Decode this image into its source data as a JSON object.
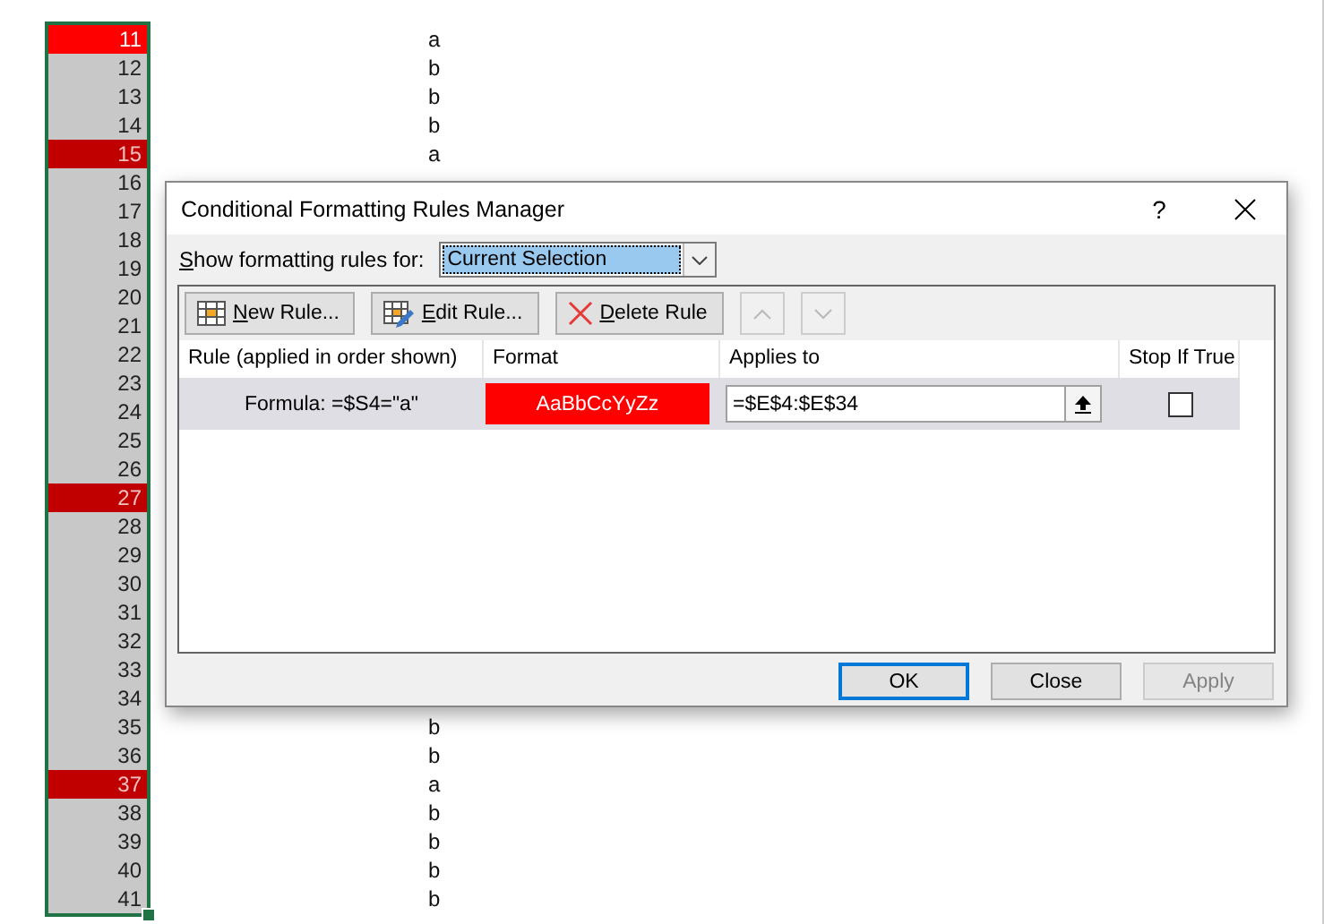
{
  "sheet": {
    "rows": [
      {
        "number": "11",
        "value": "a",
        "highlighted": true,
        "active": true
      },
      {
        "number": "12",
        "value": "b",
        "highlighted": false,
        "active": false
      },
      {
        "number": "13",
        "value": "b",
        "highlighted": false,
        "active": false
      },
      {
        "number": "14",
        "value": "b",
        "highlighted": false,
        "active": false
      },
      {
        "number": "15",
        "value": "a",
        "highlighted": true,
        "active": false
      },
      {
        "number": "16",
        "highlighted": false,
        "active": false
      },
      {
        "number": "17",
        "highlighted": false,
        "active": false
      },
      {
        "number": "18",
        "highlighted": false,
        "active": false
      },
      {
        "number": "19",
        "highlighted": false,
        "active": false
      },
      {
        "number": "20",
        "highlighted": false,
        "active": false
      },
      {
        "number": "21",
        "highlighted": false,
        "active": false
      },
      {
        "number": "22",
        "highlighted": false,
        "active": false
      },
      {
        "number": "23",
        "highlighted": false,
        "active": false
      },
      {
        "number": "24",
        "highlighted": false,
        "active": false
      },
      {
        "number": "25",
        "highlighted": false,
        "active": false
      },
      {
        "number": "26",
        "highlighted": false,
        "active": false
      },
      {
        "number": "27",
        "highlighted": true,
        "active": false
      },
      {
        "number": "28",
        "highlighted": false,
        "active": false
      },
      {
        "number": "29",
        "highlighted": false,
        "active": false
      },
      {
        "number": "30",
        "highlighted": false,
        "active": false
      },
      {
        "number": "31",
        "highlighted": false,
        "active": false
      },
      {
        "number": "32",
        "highlighted": false,
        "active": false
      },
      {
        "number": "33",
        "highlighted": false,
        "active": false
      },
      {
        "number": "34",
        "highlighted": false,
        "active": false
      },
      {
        "number": "35",
        "value": "b",
        "highlighted": false,
        "active": false
      },
      {
        "number": "36",
        "value": "b",
        "highlighted": false,
        "active": false
      },
      {
        "number": "37",
        "value": "a",
        "highlighted": true,
        "active": false
      },
      {
        "number": "38",
        "value": "b",
        "highlighted": false,
        "active": false
      },
      {
        "number": "39",
        "value": "b",
        "highlighted": false,
        "active": false
      },
      {
        "number": "40",
        "value": "b",
        "highlighted": false,
        "active": false
      },
      {
        "number": "41",
        "value": "b",
        "highlighted": false,
        "active": false
      }
    ]
  },
  "dialog": {
    "title": "Conditional Formatting Rules Manager",
    "help": "?",
    "show_rules_label": "Show formatting rules for:",
    "show_rules_value": "Current Selection",
    "toolbar": [
      {
        "kind": "new",
        "label": "New Rule...",
        "disabled": false
      },
      {
        "kind": "edit",
        "label": "Edit Rule...",
        "disabled": false
      },
      {
        "kind": "delete",
        "label": "Delete Rule",
        "disabled": false
      },
      {
        "kind": "up",
        "disabled": true
      },
      {
        "kind": "down",
        "disabled": true
      }
    ],
    "columns": [
      "Rule (applied in order shown)",
      "Format",
      "Applies to",
      "Stop If True"
    ],
    "rules": [
      {
        "rule": "Formula: =$S4=\"a\"",
        "format_preview": "AaBbCcYyZz",
        "applies_to": "=$E$4:$E$34",
        "stop_if_true": false,
        "selected": true
      }
    ],
    "buttons": [
      {
        "label": "OK",
        "default": true,
        "disabled": false
      },
      {
        "label": "Close",
        "default": false,
        "disabled": false
      },
      {
        "label": "Apply",
        "default": false,
        "disabled": true
      }
    ]
  }
}
